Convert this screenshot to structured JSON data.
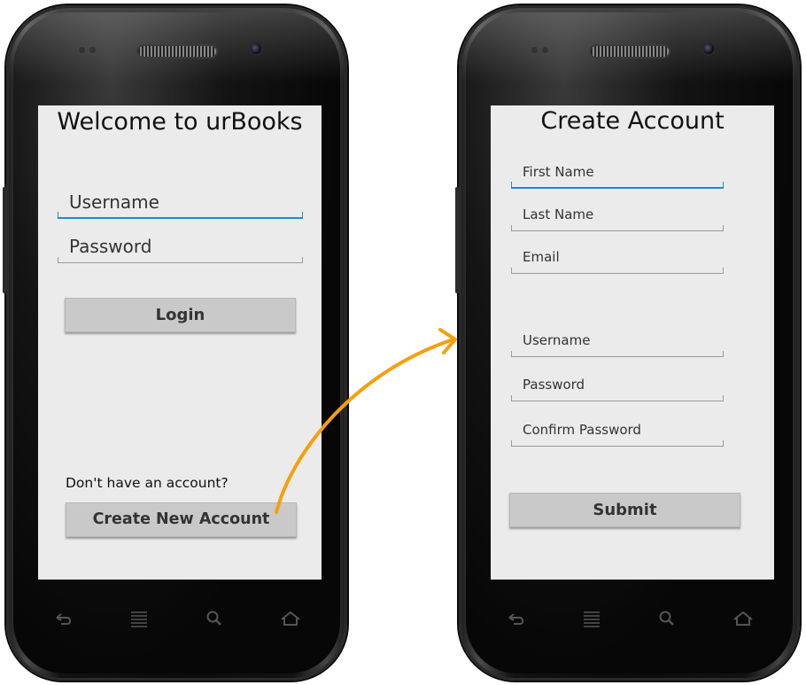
{
  "login_screen": {
    "title": "Welcome to urBooks",
    "username_placeholder": "Username",
    "password_placeholder": "Password",
    "login_button": "Login",
    "no_account_text": "Don't have an account?",
    "create_account_button": "Create New Account"
  },
  "create_account_screen": {
    "title": "Create Account",
    "first_name_placeholder": "First Name",
    "last_name_placeholder": "Last Name",
    "email_placeholder": "Email",
    "username_placeholder": "Username",
    "password_placeholder": "Password",
    "confirm_password_placeholder": "Confirm Password",
    "submit_button": "Submit"
  },
  "navbar_icons": [
    "back-icon",
    "menu-icon",
    "search-icon",
    "home-icon"
  ],
  "colors": {
    "screen_bg": "#ebebeb",
    "focus_underline": "#1e8bc3",
    "arrow": "#f5a00d",
    "button_bg": "#c9c9c9"
  }
}
